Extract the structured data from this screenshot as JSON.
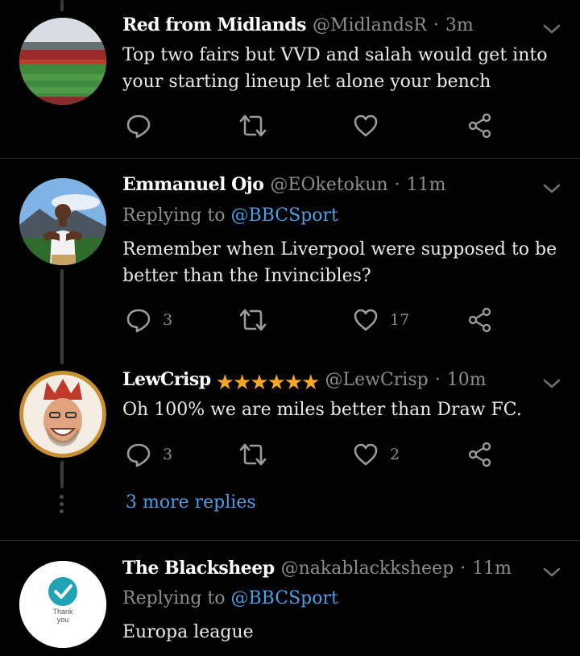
{
  "theme": {
    "background": "#000000",
    "text": "#e9e9e9",
    "muted": "#8d8d8d",
    "link": "#4a9fe6",
    "star": "#f5a623"
  },
  "tweets": [
    {
      "name": "Red from Midlands",
      "handle": "@MidlandsR",
      "separator": "·",
      "time": "3m",
      "text": "Top two fairs but VVD and salah would get into your starting lineup let alone your bench",
      "avatar_icon": "stadium-photo-avatar",
      "actions": {
        "reply_icon": "reply-icon",
        "retweet_icon": "retweet-icon",
        "like_icon": "like-heart-icon",
        "share_icon": "share-icon"
      }
    },
    {
      "name": "Emmanuel Ojo",
      "handle": "@EOketokun",
      "separator": "·",
      "time": "11m",
      "replying_prefix": "Replying to",
      "replying_to": "@BBCSport",
      "text": "Remember when Liverpool were supposed to be better than the Invincibles?",
      "reply_count": "3",
      "like_count": "17",
      "avatar_icon": "man-outdoors-photo-avatar"
    },
    {
      "name": "LewCrisp",
      "stars": "★★★★★★",
      "handle": "@LewCrisp",
      "separator": "·",
      "time": "10m",
      "text": "Oh 100% we are miles better than Draw FC.",
      "reply_count": "3",
      "like_count": "2",
      "avatar_icon": "crowned-man-photo-avatar"
    },
    {
      "name": "The Blacksheep",
      "handle": "@nakablackksheep",
      "separator": "·",
      "time": "11m",
      "replying_prefix": "Replying to",
      "replying_to": "@BBCSport",
      "text": "Europa league",
      "avatar_icon": "thank-you-check-avatar",
      "avatar_text_line1": "Thank",
      "avatar_text_line2": "you"
    }
  ],
  "more_replies": "3 more replies"
}
